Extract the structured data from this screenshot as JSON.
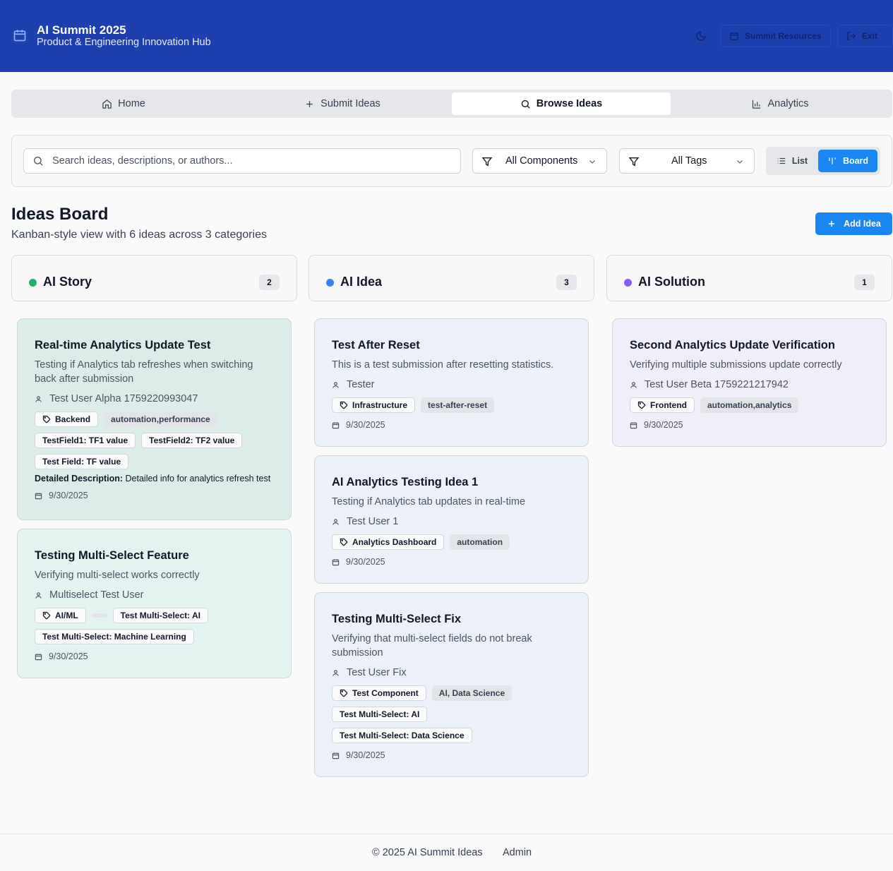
{
  "header": {
    "title": "AI Summit 2025",
    "subtitle": "Product & Engineering Innovation Hub",
    "resources_label": "Summit Resources",
    "exit_label": "Exit"
  },
  "tabs": [
    {
      "label": "Home",
      "icon": "home-icon"
    },
    {
      "label": "Submit Ideas",
      "icon": "plus-icon"
    },
    {
      "label": "Browse Ideas",
      "icon": "search-icon",
      "active": true
    },
    {
      "label": "Analytics",
      "icon": "bar-chart-icon"
    }
  ],
  "filters": {
    "search_placeholder": "Search ideas, descriptions, or authors...",
    "components_label": "All Components",
    "tags_label": "All Tags",
    "view_list": "List",
    "view_board": "Board",
    "active_view": "Board"
  },
  "board": {
    "title": "Ideas Board",
    "subtitle": "Kanban-style view with 6 ideas across 3 categories",
    "add_label": "Add Idea"
  },
  "columns": [
    {
      "name": "AI Story",
      "count": "2",
      "color": "#1fb26b",
      "cards": [
        {
          "title": "Real-time Analytics Update Test",
          "description": "Testing if Analytics tab refreshes when switching back after submission",
          "author": "Test User Alpha 1759220993047",
          "component": "Backend",
          "tags": [
            "automation,performance"
          ],
          "fields": [
            "TestField1: TF1 value",
            "TestField2: TF2 value",
            "Test Field: TF value"
          ],
          "detail_label": "Detailed Description:",
          "detail_value": "Detailed info for analytics refresh test",
          "date": "9/30/2025"
        },
        {
          "title": "Testing Multi-Select Feature",
          "description": "Verifying multi-select works correctly",
          "author": "Multiselect Test User",
          "component": "AI/ML",
          "fields": [
            "Test Multi-Select: AI",
            "Test Multi-Select: Machine Learning"
          ],
          "date": "9/30/2025"
        }
      ]
    },
    {
      "name": "AI Idea",
      "count": "3",
      "color": "#3b82f6",
      "cards": [
        {
          "title": "Test After Reset",
          "description": "This is a test submission after resetting statistics.",
          "author": "Tester",
          "component": "Infrastructure",
          "tags": [
            "test-after-reset"
          ],
          "date": "9/30/2025"
        },
        {
          "title": "AI Analytics Testing Idea 1",
          "description": "Testing if Analytics tab updates in real-time",
          "author": "Test User 1",
          "component": "Analytics Dashboard",
          "tags": [
            "automation"
          ],
          "date": "9/30/2025"
        },
        {
          "title": "Testing Multi-Select Fix",
          "description": "Verifying that multi-select fields do not break submission",
          "author": "Test User Fix",
          "component": "Test Component",
          "tags": [
            "AI, Data Science"
          ],
          "fields": [
            "Test Multi-Select: AI",
            "Test Multi-Select: Data Science"
          ],
          "date": "9/30/2025"
        }
      ]
    },
    {
      "name": "AI Solution",
      "count": "1",
      "color": "#8b5cf6",
      "cards": [
        {
          "title": "Second Analytics Update Verification",
          "description": "Verifying multiple submissions update correctly",
          "author": "Test User Beta 1759221217942",
          "component": "Frontend",
          "tags": [
            "automation,analytics"
          ],
          "date": "9/30/2025"
        }
      ]
    }
  ],
  "footer": {
    "copyright": "© 2025 AI Summit Ideas",
    "admin_label": "Admin"
  },
  "colors": {
    "header_bg": "#1e3fae",
    "accent": "#1a86f2"
  }
}
